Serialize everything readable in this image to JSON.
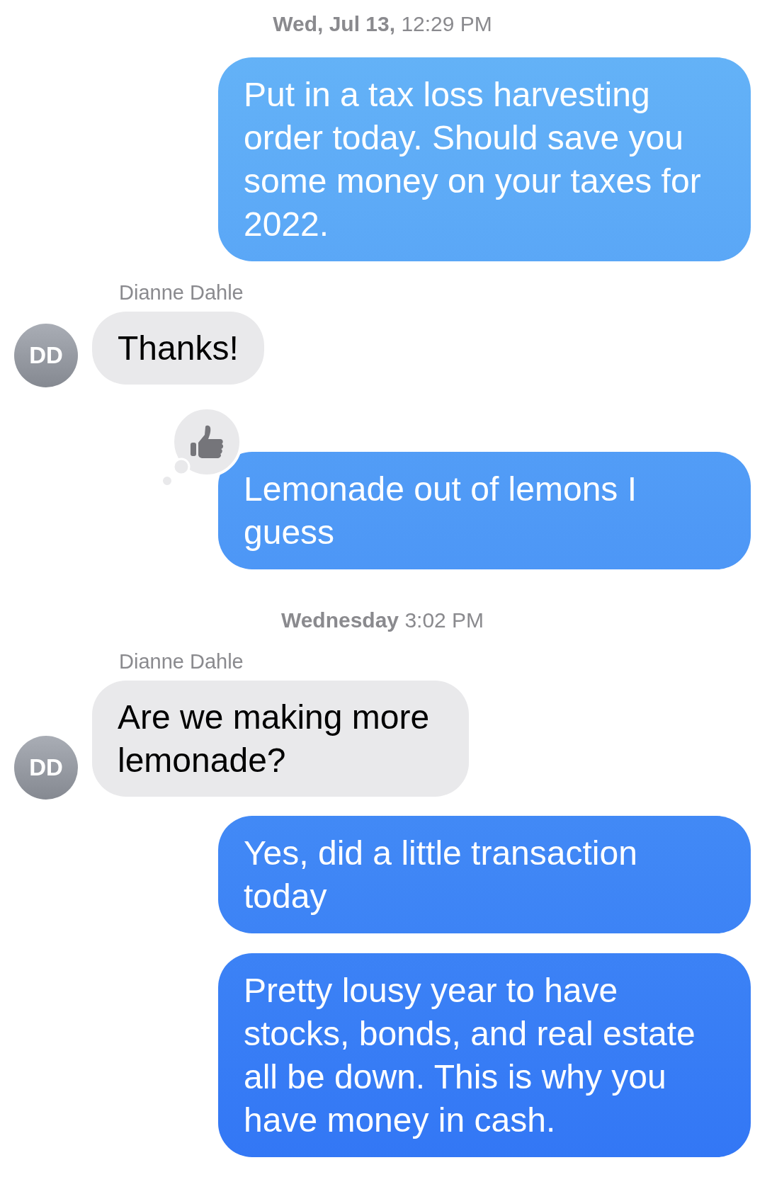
{
  "messages": [
    {
      "kind": "timestamp",
      "day": "Wed, Jul 13,",
      "time": "12:29 PM"
    },
    {
      "kind": "outgoing",
      "text": "Put in a tax loss harvesting order today. Should save you some money on your taxes for 2022."
    },
    {
      "kind": "incoming",
      "sender": "Dianne Dahle",
      "avatar": "DD",
      "text": "Thanks!"
    },
    {
      "kind": "outgoing",
      "text": "Lemonade out of lemons I guess",
      "liked": true
    },
    {
      "kind": "timestamp",
      "day": "Wednesday",
      "time": "3:02 PM"
    },
    {
      "kind": "incoming",
      "sender": "Dianne Dahle",
      "avatar": "DD",
      "text": "Are we making more lemonade?"
    },
    {
      "kind": "outgoing",
      "text": "Yes, did a little transaction today"
    },
    {
      "kind": "outgoing",
      "text": "Pretty lousy year to have stocks, bonds, and real estate all be down. This is why you have money in cash."
    }
  ]
}
